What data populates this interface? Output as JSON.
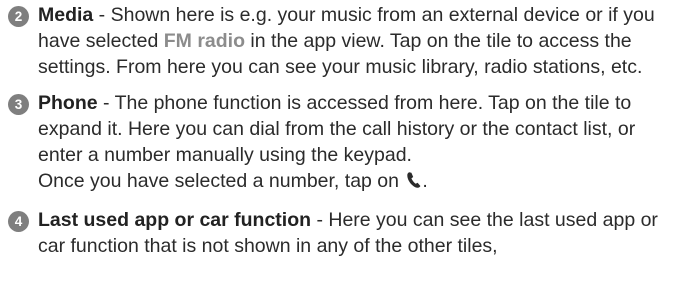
{
  "items": [
    {
      "number": "2",
      "term": "Media",
      "text_before": " - Shown here is e.g. your music from an external device or if you have selected ",
      "highlight": "FM radio",
      "text_after": " in the app view. Tap on the tile to access the settings. From here you can see your music library, radio stations, etc."
    },
    {
      "number": "3",
      "term": "Phone",
      "text_before": " - The phone function is accessed from here. Tap on the tile to expand it. Here you can dial from the call history or the contact list, or enter a number manually using the keypad.",
      "text_line2": "Once you have selected a number, tap on ",
      "text_after": ".",
      "icon": "phone-handset-icon"
    },
    {
      "number": "4",
      "term": "Last used app or car function",
      "text_before": " - Here you can see the last used app or car function that is not shown in any of the other tiles,"
    }
  ],
  "colors": {
    "badge": "#7f7f7f",
    "highlight": "#8c8c8c",
    "text": "#2b2b2b"
  }
}
